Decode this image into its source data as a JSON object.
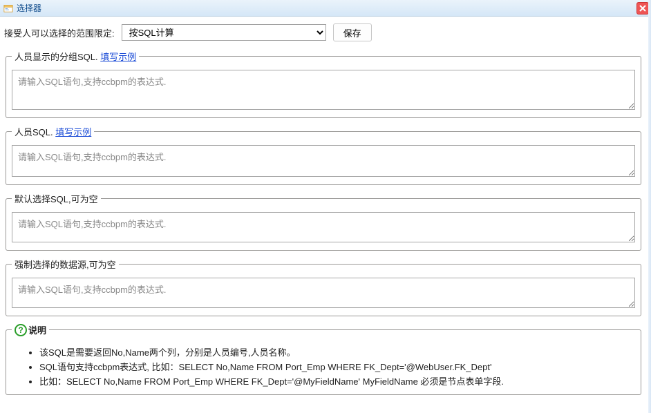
{
  "titlebar": {
    "title": "选择器"
  },
  "top": {
    "label": "接受人可以选择的范围限定:",
    "select_value": "按SQL计算",
    "save_label": "保存"
  },
  "fieldsets": {
    "group_sql": {
      "legend": "人员显示的分组SQL.",
      "link": "填写示例",
      "placeholder": "请输入SQL语句,支持ccbpm的表达式."
    },
    "person_sql": {
      "legend": "人员SQL.",
      "link": "填写示例",
      "placeholder": "请输入SQL语句,支持ccbpm的表达式."
    },
    "default_sql": {
      "legend": "默认选择SQL,可为空",
      "placeholder": "请输入SQL语句,支持ccbpm的表达式."
    },
    "force_sql": {
      "legend": "强制选择的数据源,可为空",
      "placeholder": "请输入SQL语句,支持ccbpm的表达式."
    }
  },
  "description": {
    "title": "说明",
    "items": [
      "该SQL是需要返回No,Name两个列，分别是人员编号,人员名称。",
      "SQL语句支持ccbpm表达式, 比如：SELECT No,Name FROM Port_Emp WHERE FK_Dept='@WebUser.FK_Dept'",
      "比如：SELECT No,Name FROM Port_Emp WHERE FK_Dept='@MyFieldName' MyFieldName 必须是节点表单字段."
    ]
  }
}
